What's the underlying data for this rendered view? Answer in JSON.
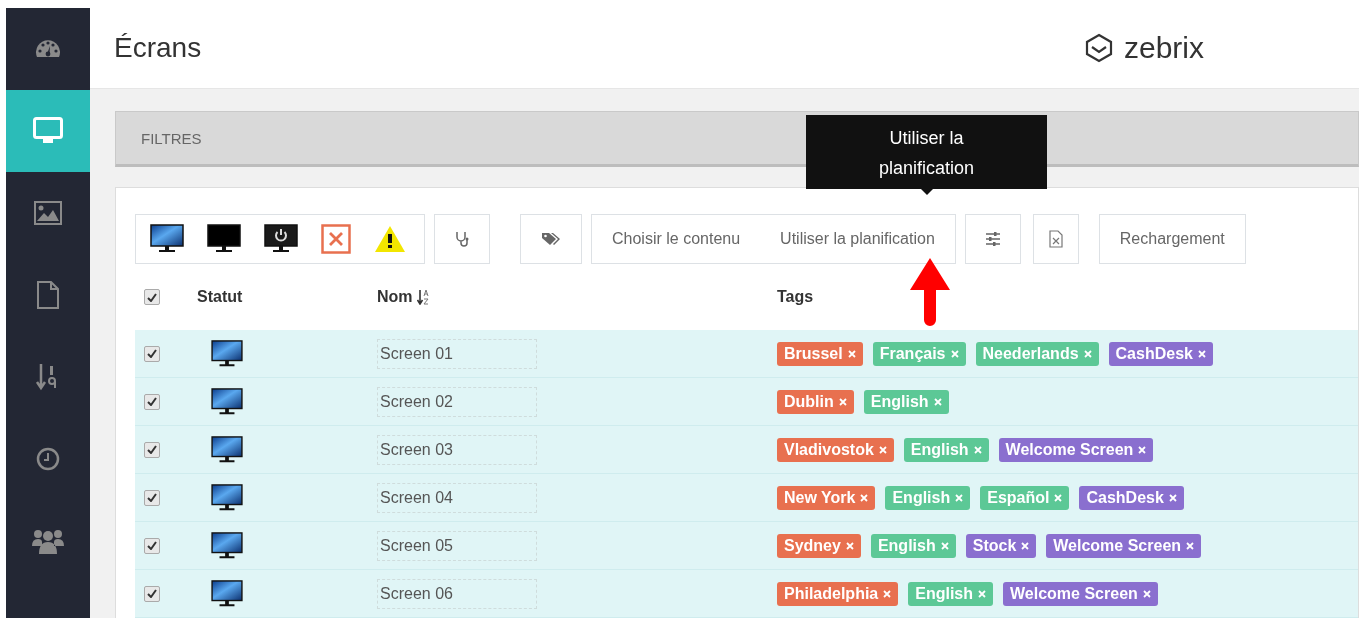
{
  "sidebar": {
    "items": [
      {
        "kind": "gauge",
        "selected": false
      },
      {
        "kind": "monitor",
        "selected": true
      },
      {
        "kind": "image",
        "selected": false
      },
      {
        "kind": "file",
        "selected": false
      },
      {
        "kind": "sort",
        "selected": false
      },
      {
        "kind": "clock",
        "selected": false
      },
      {
        "kind": "users",
        "selected": false
      }
    ]
  },
  "header": {
    "title": "Écrans",
    "logo": "zebrix"
  },
  "filters": {
    "label": "FILTRES"
  },
  "toolbar": {
    "status_filters": [
      {
        "kind": "online"
      },
      {
        "kind": "offline"
      },
      {
        "kind": "standby"
      },
      {
        "kind": "error"
      },
      {
        "kind": "warning"
      }
    ],
    "actions": [
      "Choisir le contenu",
      "Utiliser la planification"
    ],
    "reload": "Rechargement"
  },
  "tooltip": {
    "text": "Utiliser la planification"
  },
  "table": {
    "columns": [
      "Statut",
      "Nom",
      "Tags"
    ],
    "all_checked": true,
    "rows": [
      {
        "checked": true,
        "kind": "online",
        "name": "Screen 01",
        "tags": [
          {
            "label": "Brussel",
            "color": "#e8704f"
          },
          {
            "label": "Français",
            "color": "#5cc896"
          },
          {
            "label": "Neederlands",
            "color": "#5cc896"
          },
          {
            "label": "CashDesk",
            "color": "#8a6fcf"
          }
        ]
      },
      {
        "checked": true,
        "kind": "online",
        "name": "Screen 02",
        "tags": [
          {
            "label": "Dublin",
            "color": "#e8704f"
          },
          {
            "label": "English",
            "color": "#5cc896"
          }
        ]
      },
      {
        "checked": true,
        "kind": "online",
        "name": "Screen 03",
        "tags": [
          {
            "label": "Vladivostok",
            "color": "#e8704f"
          },
          {
            "label": "English",
            "color": "#5cc896"
          },
          {
            "label": "Welcome Screen",
            "color": "#8a6fcf"
          }
        ]
      },
      {
        "checked": true,
        "kind": "online",
        "name": "Screen 04",
        "tags": [
          {
            "label": "New York",
            "color": "#e8704f"
          },
          {
            "label": "English",
            "color": "#5cc896"
          },
          {
            "label": "Español",
            "color": "#5cc896"
          },
          {
            "label": "CashDesk",
            "color": "#8a6fcf"
          }
        ]
      },
      {
        "checked": true,
        "kind": "online",
        "name": "Screen 05",
        "tags": [
          {
            "label": "Sydney",
            "color": "#e8704f"
          },
          {
            "label": "English",
            "color": "#5cc896"
          },
          {
            "label": "Stock",
            "color": "#8a6fcf"
          },
          {
            "label": "Welcome Screen",
            "color": "#8a6fcf"
          }
        ]
      },
      {
        "checked": true,
        "kind": "online",
        "name": "Screen 06",
        "tags": [
          {
            "label": "Philadelphia",
            "color": "#e8704f"
          },
          {
            "label": "English",
            "color": "#5cc896"
          },
          {
            "label": "Welcome Screen",
            "color": "#8a6fcf"
          }
        ]
      }
    ]
  }
}
